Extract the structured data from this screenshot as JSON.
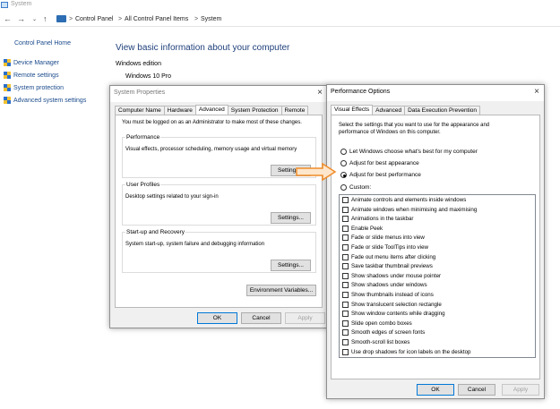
{
  "window": {
    "title": "System",
    "breadcrumb": [
      "Control Panel",
      "All Control Panel Items",
      "System"
    ]
  },
  "sidebar": {
    "home": "Control Panel Home",
    "items": [
      "Device Manager",
      "Remote settings",
      "System protection",
      "Advanced system settings"
    ]
  },
  "main": {
    "heading": "View basic information about your computer",
    "edition_label": "Windows edition",
    "edition_value": "Windows 10 Pro"
  },
  "system_properties": {
    "title": "System Properties",
    "tabs": [
      "Computer Name",
      "Hardware",
      "Advanced",
      "System Protection",
      "Remote"
    ],
    "active_tab": "Advanced",
    "admin_note": "You must be logged on as an Administrator to make most of these changes.",
    "groups": [
      {
        "label": "Performance",
        "text": "Visual effects, processor scheduling, memory usage and virtual memory",
        "button": "Settings..."
      },
      {
        "label": "User Profiles",
        "text": "Desktop settings related to your sign-in",
        "button": "Settings..."
      },
      {
        "label": "Start-up and Recovery",
        "text": "System start-up, system failure and debugging information",
        "button": "Settings..."
      }
    ],
    "env_button": "Environment Variables...",
    "ok": "OK",
    "cancel": "Cancel",
    "apply": "Apply"
  },
  "performance_options": {
    "title": "Performance Options",
    "tabs": [
      "Visual Effects",
      "Advanced",
      "Data Execution Prevention"
    ],
    "active_tab": "Visual Effects",
    "description": [
      "Select the settings that you want to use for the appearance and",
      "performance of Windows on this computer."
    ],
    "radios": [
      {
        "label": "Let Windows choose what's best for my computer",
        "checked": false
      },
      {
        "label": "Adjust for best appearance",
        "checked": false
      },
      {
        "label": "Adjust for best performance",
        "checked": true
      },
      {
        "label": "Custom:",
        "checked": false
      }
    ],
    "checkboxes": [
      "Animate controls and elements inside windows",
      "Animate windows when minimising and maximising",
      "Animations in the taskbar",
      "Enable Peek",
      "Fade or slide menus into view",
      "Fade or slide ToolTips into view",
      "Fade out menu items after clicking",
      "Save taskbar thumbnail previews",
      "Show shadows under mouse pointer",
      "Show shadows under windows",
      "Show thumbnails instead of icons",
      "Show translucent selection rectangle",
      "Show window contents while dragging",
      "Slide open combo boxes",
      "Smooth edges of screen fonts",
      "Smooth-scroll list boxes",
      "Use drop shadows for icon labels on the desktop"
    ],
    "ok": "OK",
    "cancel": "Cancel",
    "apply": "Apply"
  },
  "colors": {
    "link": "#1a4a8c",
    "heading": "#1e3f7a",
    "arrow": "#f08c28",
    "accent": "#0078d7"
  }
}
